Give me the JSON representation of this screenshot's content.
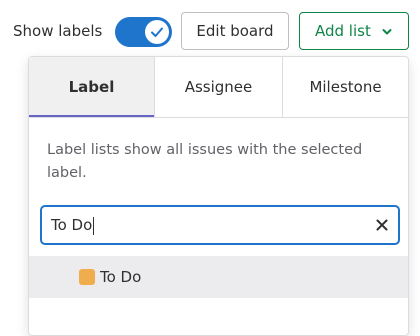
{
  "header": {
    "show_labels_text": "Show labels",
    "show_labels_on": true,
    "edit_board_label": "Edit board",
    "add_list_label": "Add list"
  },
  "dropdown": {
    "tabs": [
      {
        "label": "Label",
        "active": true
      },
      {
        "label": "Assignee",
        "active": false
      },
      {
        "label": "Milestone",
        "active": false
      }
    ],
    "help_text": "Label lists show all issues with the selected label.",
    "search": {
      "value": "To Do",
      "placeholder": ""
    },
    "results": [
      {
        "label": "To Do",
        "color": "#f0ad4e"
      }
    ]
  },
  "colors": {
    "toggle_on": "#1f75cb",
    "confirm_green": "#108548",
    "active_tab_underline": "#6666c4",
    "focus_blue": "#1f75cb"
  },
  "icons": {
    "toggle": "check-icon",
    "add_list": "chevron-down-icon",
    "search_clear": "close-icon"
  }
}
